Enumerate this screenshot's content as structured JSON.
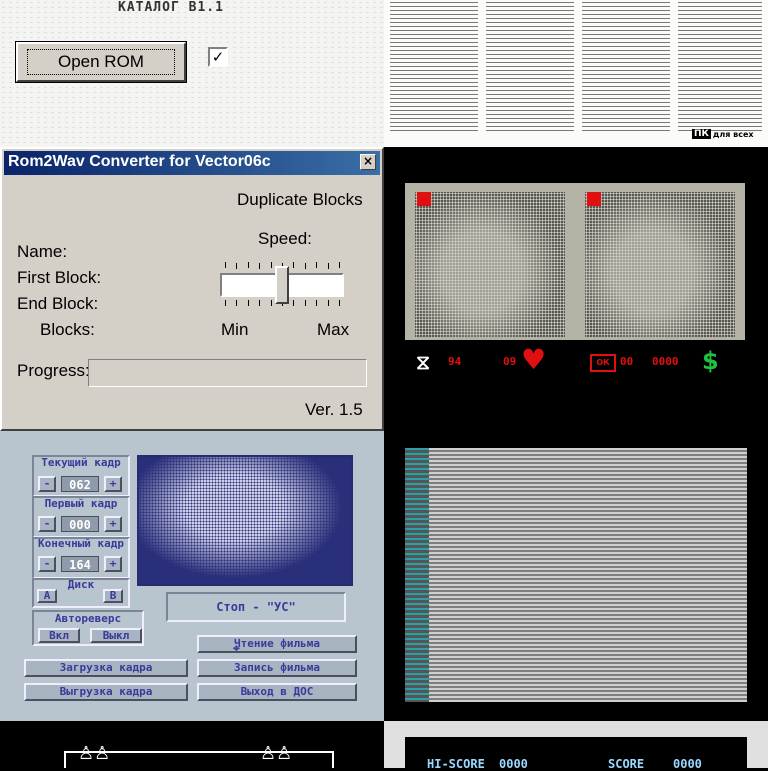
{
  "catalog": {
    "title": "КАТАЛОГ  В1.1"
  },
  "newspaper": {
    "logo_badge": "ПК",
    "logo_text": "для всех"
  },
  "rom2wav": {
    "title": "Rom2Wav Converter for Vector06c",
    "close_glyph": "×",
    "open_rom_label": "Open ROM",
    "duplicate_blocks_label": "Duplicate Blocks",
    "duplicate_blocks_checked": true,
    "speed_label": "Speed:",
    "speed_min_label": "Min",
    "speed_max_label": "Max",
    "speed_level": 0.5,
    "name_label": "Name:",
    "first_block_label": "First Block:",
    "end_block_label": "End Block:",
    "blocks_label": "Blocks:",
    "progress_label": "Progress:",
    "progress_value": 0,
    "version": "Ver. 1.5"
  },
  "game": {
    "hud_left_value": "94",
    "hud_lives": "09",
    "hud_badge": "ОК",
    "hud_money1": "00",
    "hud_money2": "0000",
    "heart_glyph": "♥",
    "dollar_glyph": "$"
  },
  "film_player": {
    "current_frame_label": "Текущий кадр",
    "current_frame_value": "062",
    "first_frame_label": "Первый кадр",
    "first_frame_value": "000",
    "last_frame_label": "Конечный кадр",
    "last_frame_value": "164",
    "minus": "-",
    "plus": "+",
    "disk_label": "Диск",
    "disk_a": "A",
    "disk_b": "B",
    "autoreverse_label": "Автореверс",
    "on_label": "Вкл",
    "off_label": "Выкл",
    "status": "Стоп - \"УС\"",
    "read_film": "Чтение фильма",
    "load_frame": "Загрузка кадра",
    "write_film": "Запись фильма",
    "unload_frame": "Выгрузка кадра",
    "exit_dos": "Выход в ДОС"
  },
  "score": {
    "hi_score_label": "HI-SCORE",
    "hi_score_value": "0000",
    "score_label": "SCORE",
    "score_value": "0000"
  }
}
